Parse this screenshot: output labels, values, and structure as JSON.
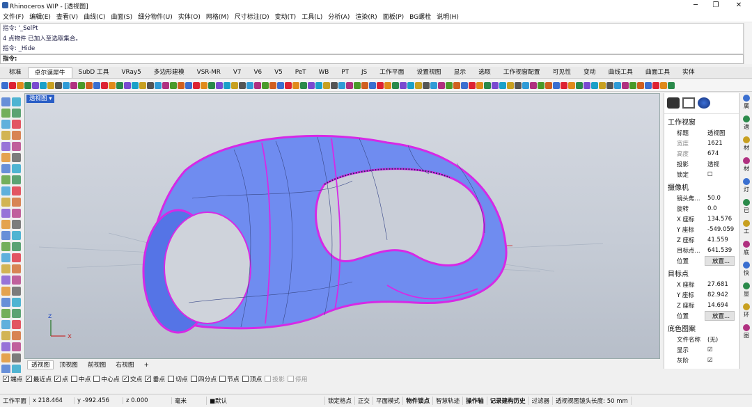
{
  "window": {
    "title": "Rhinoceros WIP - [透视图]",
    "minimize": "─",
    "maximize": "❐",
    "close": "✕"
  },
  "menu": [
    "文件(F)",
    "编辑(E)",
    "查看(V)",
    "曲线(C)",
    "曲面(S)",
    "细分物件(U)",
    "实体(O)",
    "网格(M)",
    "尺寸标注(D)",
    "变动(T)",
    "工具(L)",
    "分析(A)",
    "渲染(R)",
    "面板(P)",
    "BG螺栓",
    "说明(H)"
  ],
  "command": {
    "history": [
      "指令: '_SelPt",
      "4 点物件 已加入至选取集合。",
      "指令: _Hide"
    ],
    "prompt": "指令:"
  },
  "toolbar_tabs": [
    "标准",
    "卓尔谟犀牛",
    "SubD 工具",
    "VRay5",
    "多边形建模",
    "VSR-MR",
    "V7",
    "V6",
    "V5",
    "PeT",
    "WB",
    "PT",
    "JS",
    "工作平面",
    "设置视图",
    "显示",
    "选取",
    "工作视窗配置",
    "可见性",
    "变动",
    "曲线工具",
    "曲面工具",
    "实体"
  ],
  "active_tab": "卓尔谟犀牛",
  "viewport": {
    "label": "透视图 ▾",
    "axes": {
      "z": "z",
      "x": "x",
      "y": "y"
    }
  },
  "viewport_tabs": [
    "透视图",
    "顶视图",
    "前视图",
    "右视图"
  ],
  "viewport_add": "+",
  "osnap": [
    {
      "label": "端点",
      "checked": true
    },
    {
      "label": "最近点",
      "checked": true
    },
    {
      "label": "点",
      "checked": true
    },
    {
      "label": "中点",
      "checked": false
    },
    {
      "label": "中心点",
      "checked": false
    },
    {
      "label": "交点",
      "checked": true
    },
    {
      "label": "垂点",
      "checked": true
    },
    {
      "label": "切点",
      "checked": false
    },
    {
      "label": "四分点",
      "checked": false
    },
    {
      "label": "节点",
      "checked": false
    },
    {
      "label": "顶点",
      "checked": false
    },
    {
      "label": "投影",
      "checked": false,
      "disabled": true
    },
    {
      "label": "停用",
      "checked": false,
      "disabled": true
    }
  ],
  "status": {
    "cplane": "工作平面",
    "x": "x 218.464",
    "y": "y -992.456",
    "z": "z 0.000",
    "unit": "毫米",
    "layer": "■默认",
    "lock_grid": "锁定格点",
    "ortho": "正交",
    "planar": "平面模式",
    "osnap": "物件锁点",
    "smarttrack": "智慧轨迹",
    "gumball": "操作轴",
    "history": "记录建构历史",
    "filter": "过滤器",
    "lens": "透视视图镜头长度: 50 mm"
  },
  "properties": {
    "viewport_header": "工作视窗",
    "viewport_rows": [
      {
        "k": "标题",
        "v": "透视图"
      },
      {
        "k": "宽度",
        "v": "1621"
      },
      {
        "k": "高度",
        "v": "674"
      },
      {
        "k": "投影",
        "v": "透视"
      },
      {
        "k": "锁定",
        "v": "☐"
      }
    ],
    "camera_header": "摄像机",
    "camera_rows": [
      {
        "k": "镜头焦...",
        "v": "50.0"
      },
      {
        "k": "旋转",
        "v": "0.0"
      },
      {
        "k": "X 座标",
        "v": "134.576"
      },
      {
        "k": "Y 座标",
        "v": "-549.059"
      },
      {
        "k": "Z 座标",
        "v": "41.559"
      },
      {
        "k": "目标点...",
        "v": "641.539"
      },
      {
        "k": "位置",
        "v": "放置..."
      }
    ],
    "target_header": "目标点",
    "target_rows": [
      {
        "k": "X 座标",
        "v": "27.681"
      },
      {
        "k": "Y 座标",
        "v": "82.942"
      },
      {
        "k": "Z 座标",
        "v": "14.694"
      },
      {
        "k": "位置",
        "v": "放置..."
      }
    ],
    "wallpaper_header": "底色图案",
    "wallpaper_rows": [
      {
        "k": "文件名称",
        "v": "(无)"
      },
      {
        "k": "显示",
        "v": "☑"
      },
      {
        "k": "灰阶",
        "v": "☑"
      }
    ]
  },
  "right_strip": [
    "属",
    "適",
    "材",
    "材",
    "灯",
    "已",
    "工",
    "底",
    "快",
    "显",
    "环",
    "图"
  ]
}
